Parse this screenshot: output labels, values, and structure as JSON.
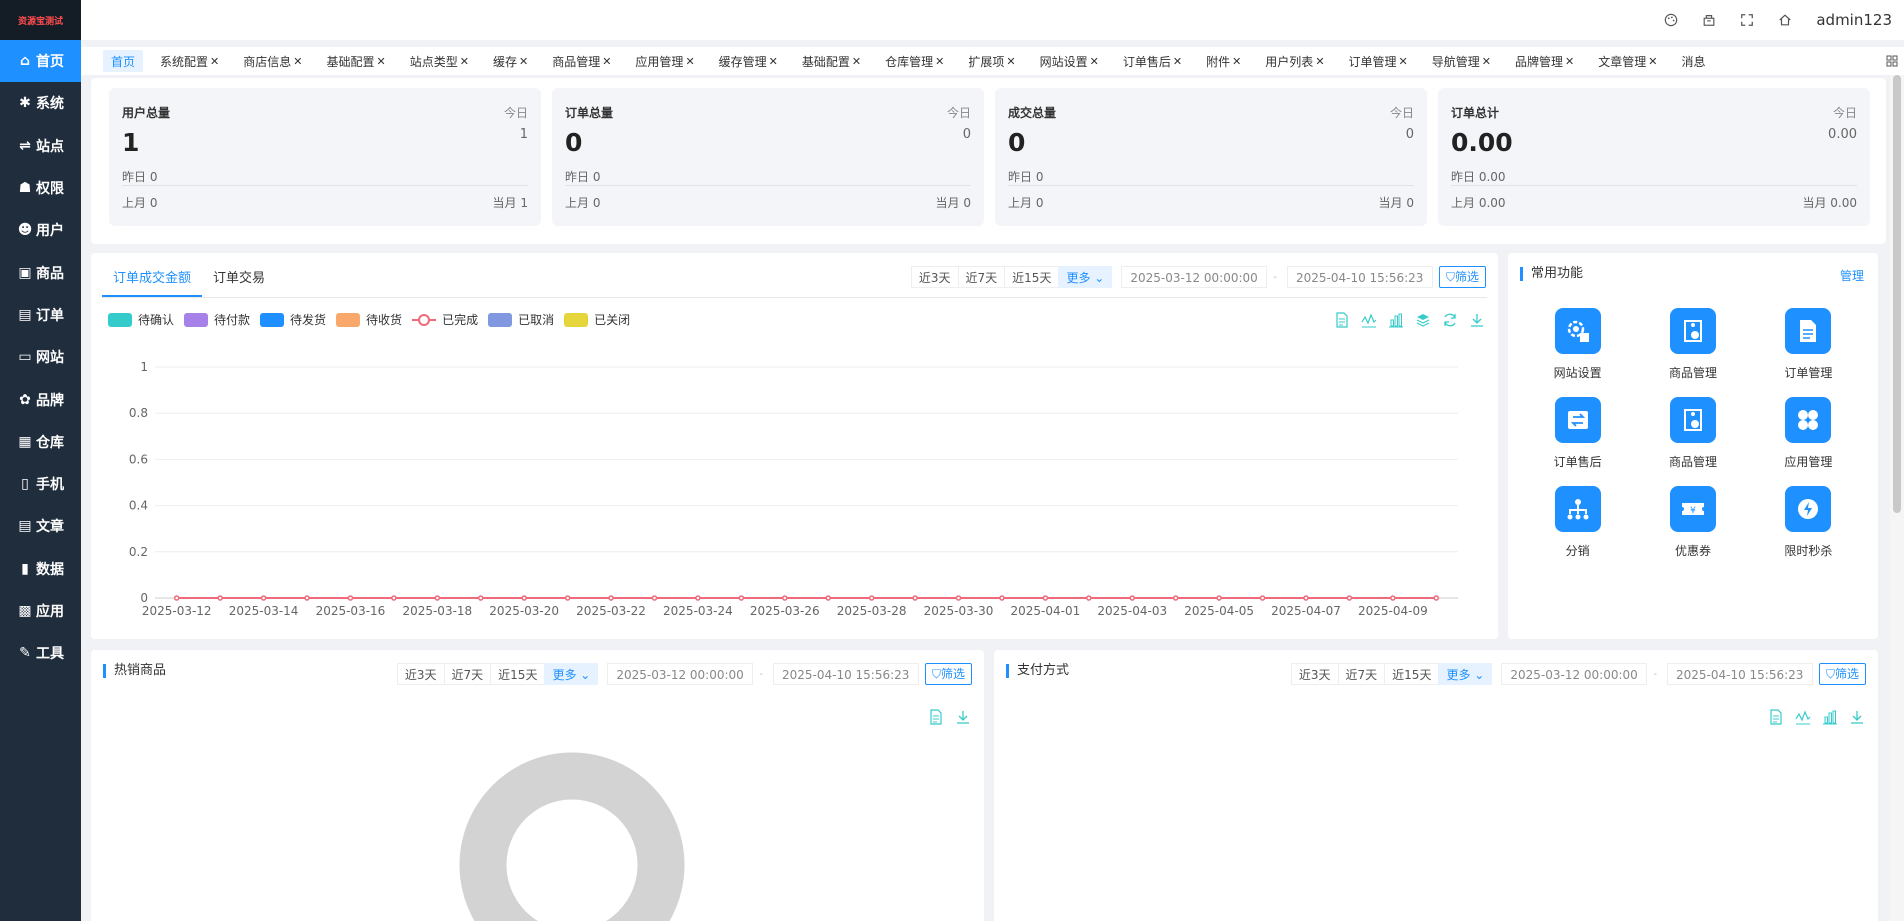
{
  "sidebar": {
    "logo": "资源宝测试",
    "items": [
      {
        "label": "首页",
        "icon": "home-icon"
      },
      {
        "label": "系统",
        "icon": "gear-icon"
      },
      {
        "label": "站点",
        "icon": "sliders-icon"
      },
      {
        "label": "权限",
        "icon": "user-lock-icon"
      },
      {
        "label": "用户",
        "icon": "user-icon"
      },
      {
        "label": "商品",
        "icon": "box-icon"
      },
      {
        "label": "订单",
        "icon": "clipboard-icon"
      },
      {
        "label": "网站",
        "icon": "monitor-icon"
      },
      {
        "label": "品牌",
        "icon": "brand-icon"
      },
      {
        "label": "仓库",
        "icon": "warehouse-icon"
      },
      {
        "label": "手机",
        "icon": "mobile-icon"
      },
      {
        "label": "文章",
        "icon": "article-icon"
      },
      {
        "label": "数据",
        "icon": "bar-chart-icon"
      },
      {
        "label": "应用",
        "icon": "grid-icon"
      },
      {
        "label": "工具",
        "icon": "wrench-icon"
      }
    ]
  },
  "topbar": {
    "user": "admin123"
  },
  "tabs": [
    "首页",
    "系统配置",
    "商店信息",
    "基础配置",
    "站点类型",
    "缓存",
    "商品管理",
    "应用管理",
    "缓存管理",
    "基础配置",
    "仓库管理",
    "扩展项",
    "网站设置",
    "订单售后",
    "附件",
    "用户列表",
    "订单管理",
    "导航管理",
    "品牌管理",
    "文章管理",
    "消息"
  ],
  "stats": [
    {
      "title": "用户总量",
      "value": "1",
      "today_label": "今日",
      "today": "1",
      "yesterday": "昨日  0",
      "last_month": "上月  0",
      "this_month": "当月  1"
    },
    {
      "title": "订单总量",
      "value": "0",
      "today_label": "今日",
      "today": "0",
      "yesterday": "昨日 0",
      "last_month": "上月  0",
      "this_month": "当月  0"
    },
    {
      "title": "成交总量",
      "value": "0",
      "today_label": "今日",
      "today": "0",
      "yesterday": "昨日 0",
      "last_month": "上月  0",
      "this_month": "当月  0"
    },
    {
      "title": "订单总计",
      "value": "0.00",
      "today_label": "今日",
      "today": "0.00",
      "yesterday": "昨日 0.00",
      "last_month": "上月  0.00",
      "this_month": "当月  0.00"
    }
  ],
  "filters": {
    "d3": "近3天",
    "d7": "近7天",
    "d15": "近15天",
    "more": "更多",
    "start": "2025-03-12 00:00:00",
    "end": "2025-04-10 15:56:23",
    "filter": "筛选"
  },
  "order_panel": {
    "tabs": [
      "订单成交金额",
      "订单交易"
    ],
    "legend": [
      {
        "name": "待确认",
        "color": "#36cbcb"
      },
      {
        "name": "待付款",
        "color": "#a581e8"
      },
      {
        "name": "待发货",
        "color": "#1e90ff"
      },
      {
        "name": "待收货",
        "color": "#f8a86a"
      },
      {
        "name": "已完成",
        "color": "#ef6a7a"
      },
      {
        "name": "已取消",
        "color": "#7f98e0"
      },
      {
        "name": "已关闭",
        "color": "#e6d63c"
      }
    ]
  },
  "chart_data": {
    "type": "line",
    "x": [
      "2025-03-12",
      "2025-03-13",
      "2025-03-14",
      "2025-03-15",
      "2025-03-16",
      "2025-03-17",
      "2025-03-18",
      "2025-03-19",
      "2025-03-20",
      "2025-03-21",
      "2025-03-22",
      "2025-03-23",
      "2025-03-24",
      "2025-03-25",
      "2025-03-26",
      "2025-03-27",
      "2025-03-28",
      "2025-03-29",
      "2025-03-30",
      "2025-03-31",
      "2025-04-01",
      "2025-04-02",
      "2025-04-03",
      "2025-04-04",
      "2025-04-05",
      "2025-04-06",
      "2025-04-07",
      "2025-04-08",
      "2025-04-09",
      "2025-04-10"
    ],
    "x_tick_labels": [
      "2025-03-12",
      "2025-03-14",
      "2025-03-16",
      "2025-03-18",
      "2025-03-20",
      "2025-03-22",
      "2025-03-24",
      "2025-03-26",
      "2025-03-28",
      "2025-03-30",
      "2025-04-01",
      "2025-04-03",
      "2025-04-05",
      "2025-04-07",
      "2025-04-09"
    ],
    "y_ticks": [
      "0",
      "0.2",
      "0.4",
      "0.6",
      "0.8",
      "1"
    ],
    "ylim": [
      0,
      1
    ],
    "series": [
      {
        "name": "已完成",
        "color": "#ef6a7a",
        "values": [
          0,
          0,
          0,
          0,
          0,
          0,
          0,
          0,
          0,
          0,
          0,
          0,
          0,
          0,
          0,
          0,
          0,
          0,
          0,
          0,
          0,
          0,
          0,
          0,
          0,
          0,
          0,
          0,
          0,
          0
        ]
      }
    ],
    "grid": true,
    "legend_position": "top-left"
  },
  "quick": {
    "title": "常用功能",
    "manage": "管理",
    "items": [
      {
        "label": "网站设置",
        "icon": "site-settings-icon"
      },
      {
        "label": "商品管理",
        "icon": "product-icon"
      },
      {
        "label": "订单管理",
        "icon": "document-icon"
      },
      {
        "label": "订单售后",
        "icon": "exchange-icon"
      },
      {
        "label": "商品管理",
        "icon": "product-icon"
      },
      {
        "label": "应用管理",
        "icon": "apps-icon"
      },
      {
        "label": "分销",
        "icon": "distribution-icon"
      },
      {
        "label": "优惠券",
        "icon": "coupon-icon"
      },
      {
        "label": "限时秒杀",
        "icon": "flash-sale-icon"
      }
    ]
  },
  "hot_goods": {
    "title": "热销商品"
  },
  "payment": {
    "title": "支付方式"
  }
}
